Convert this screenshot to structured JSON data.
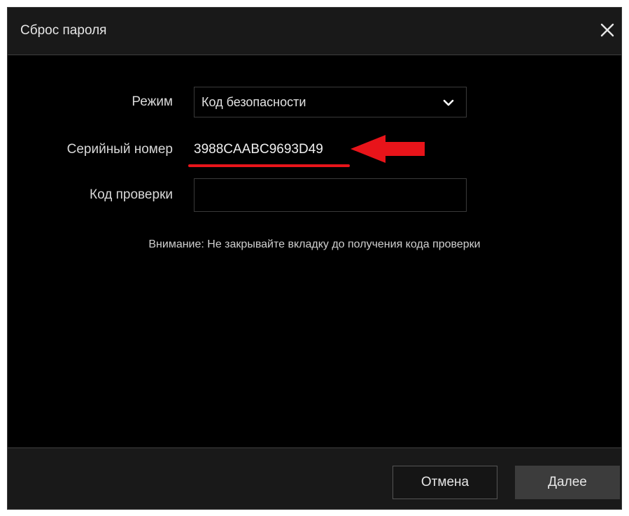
{
  "dialog": {
    "title": "Сброс пароля",
    "close_icon": "close-icon"
  },
  "form": {
    "mode_label": "Режим",
    "mode_value": "Код безопасности",
    "mode_icon": "chevron-down-icon",
    "serial_label": "Серийный номер",
    "serial_value": "3988CAABC9693D49",
    "verification_label": "Код проверки",
    "verification_value": "",
    "verification_placeholder": ""
  },
  "notice": "Внимание: Не закрывайте вкладку до получения кода проверки",
  "buttons": {
    "cancel": "Отмена",
    "next": "Далее"
  },
  "annotation": {
    "color": "#e8141a",
    "arrow_icon": "arrow-left-icon"
  },
  "colors": {
    "background": "#000000",
    "bar": "#191919",
    "border": "#3a3a3a",
    "next_button": "#3c3c3c"
  }
}
